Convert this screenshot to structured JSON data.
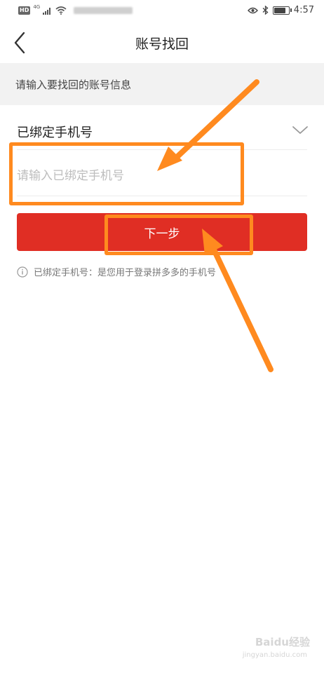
{
  "status_bar": {
    "hd": "HD",
    "network": "4G",
    "time": "4:57",
    "battery_level": 0.85,
    "icons": [
      "signal-icon",
      "wifi-icon",
      "eye-icon",
      "bluetooth-icon",
      "battery-icon"
    ]
  },
  "nav": {
    "title": "账号找回",
    "back_icon": "chevron-left-icon"
  },
  "section": {
    "header": "请输入要找回的账号信息"
  },
  "form": {
    "phone_label": "已绑定手机号",
    "phone_placeholder": "请输入已绑定手机号",
    "phone_value": "",
    "dropdown_icon": "chevron-down-icon"
  },
  "next_button": {
    "label": "下一步"
  },
  "hint": {
    "icon": "info-icon",
    "text": "已绑定手机号：是您用于登录拼多多的手机号"
  },
  "annotation": {
    "color": "#ff8a1f"
  },
  "colors": {
    "primary": "#e02e24",
    "background": "#ffffff",
    "section_bg": "#f2f2f2"
  },
  "watermark": {
    "text": "Baidu经验",
    "sub": "jingyan.baidu.com"
  }
}
